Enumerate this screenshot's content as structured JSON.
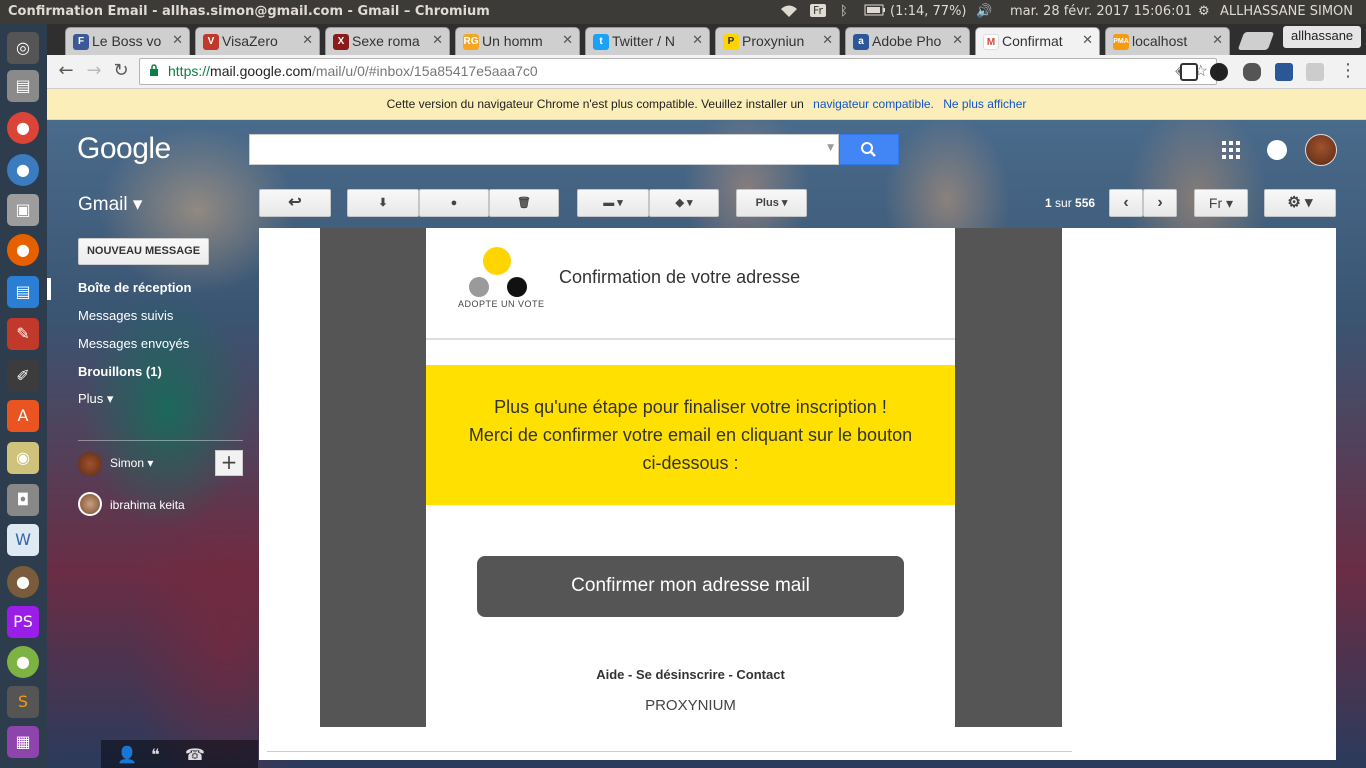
{
  "topbar": {
    "window_title": "Confirmation Email - allhas.simon@gmail.com - Gmail – Chromium",
    "keyboard_layout": "Fr",
    "battery": "(1:14, 77%)",
    "datetime": "mar. 28 févr. 2017 15:06:01",
    "user": "ALLHASSANE SIMON"
  },
  "launcher": {
    "items": [
      "dash-icon",
      "files-icon",
      "chrome-icon",
      "chromium-icon",
      "image-viewer-icon",
      "firefox-icon",
      "writer-icon",
      "settings-icon",
      "pen-icon",
      "software-center-icon",
      "media-player-icon",
      "camera-icon",
      "mysql-workbench-icon",
      "gimp-icon",
      "phpstorm-icon",
      "android-icon",
      "sublime-text-icon",
      "archive-icon"
    ]
  },
  "tabs": [
    {
      "title": "Le Boss vo",
      "favicon": "F",
      "color": "#3b5998"
    },
    {
      "title": "VisaZero",
      "favicon": "V",
      "color": "#c0392b"
    },
    {
      "title": "Sexe roma",
      "favicon": "X",
      "color": "#8b1a1a"
    },
    {
      "title": "Un homm",
      "favicon": "RG",
      "color": "#f5a623"
    },
    {
      "title": "Twitter / N",
      "favicon": "t",
      "color": "#1da1f2"
    },
    {
      "title": "Proxyniun",
      "favicon": "P",
      "color": "#ffd400"
    },
    {
      "title": "Adobe Pho",
      "favicon": "a",
      "color": "#2b5797"
    },
    {
      "title": "Confirmat",
      "favicon": "M",
      "color": "#d44638"
    },
    {
      "title": "localhost",
      "favicon": "PMA",
      "color": "#f39c12"
    }
  ],
  "profile_button": "allhassane",
  "omnibox": {
    "scheme": "https://",
    "host": "mail.google.com",
    "path": "/mail/u/0/#inbox/15a85417e5aaa7c0"
  },
  "infobar": {
    "message": "Cette version du navigateur Chrome n'est plus compatible. Veuillez installer un",
    "link1": "navigateur compatible.",
    "link2": "Ne plus afficher"
  },
  "gmail": {
    "logo": "Google",
    "search_placeholder": "",
    "app_label": "Gmail",
    "more_button": "Plus",
    "pager_pre": "1",
    "pager_mid": "sur",
    "pager_total": "556",
    "lang_button": "Fr",
    "compose": "NOUVEAU MESSAGE",
    "nav": [
      {
        "label": "Boîte de réception",
        "bold": true
      },
      {
        "label": "Messages suivis",
        "bold": false
      },
      {
        "label": "Messages envoyés",
        "bold": false
      },
      {
        "label": "Brouillons (1)",
        "bold": true
      },
      {
        "label": "Plus ▾",
        "bold": false
      }
    ],
    "chat_contacts": [
      "Simon ▾",
      "ibrahima keita"
    ]
  },
  "email": {
    "logo_text": "ADOPTE UN VOTE",
    "title": "Confirmation de votre adresse",
    "line1": "Plus qu'une étape pour finaliser votre inscription !",
    "line2": "Merci de confirmer votre email en cliquant sur le bouton",
    "line3": "ci-dessous :",
    "button": "Confirmer mon adresse mail",
    "footer_links": "Aide - Se désinscrire - Contact",
    "brand": "PROXYNIUM"
  }
}
